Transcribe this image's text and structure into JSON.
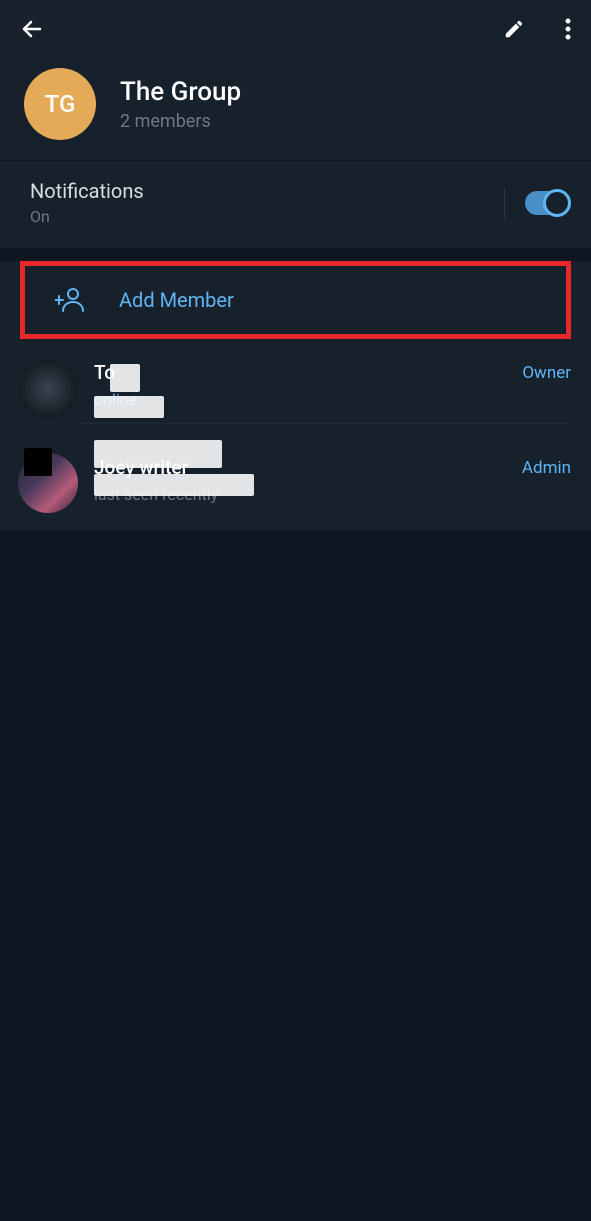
{
  "header": {
    "avatar_initials": "TG",
    "group_name": "The Group",
    "member_count": "2 members"
  },
  "notifications": {
    "label": "Notifications",
    "status": "On"
  },
  "add_member": {
    "label": "Add Member"
  },
  "members": [
    {
      "name": "To",
      "status": "online",
      "role": "Owner",
      "status_type": "online"
    },
    {
      "name": "Joey writer",
      "status": "last seen recently",
      "role": "Admin",
      "status_type": "offline"
    }
  ]
}
